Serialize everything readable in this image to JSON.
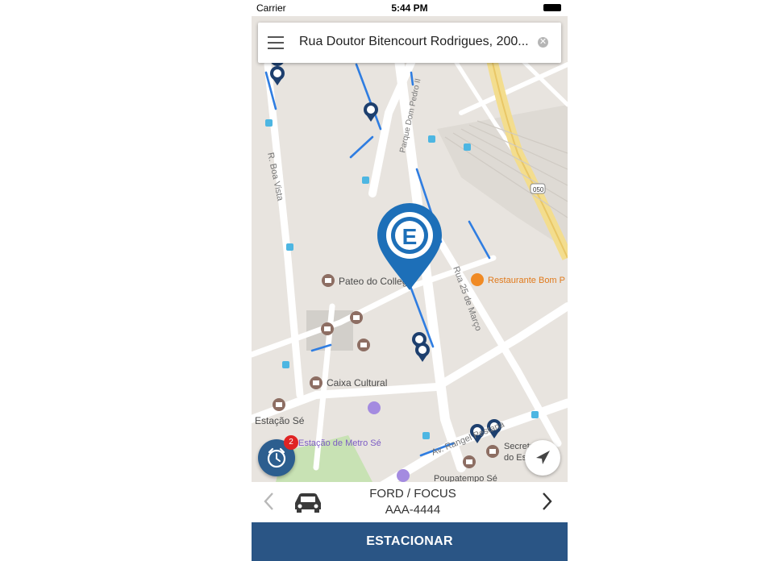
{
  "status_bar": {
    "carrier": "Carrier",
    "time": "5:44 PM"
  },
  "search": {
    "query": "Rua Doutor Bitencourt Rodrigues, 200..."
  },
  "map": {
    "labels": {
      "pateo": "Pateo do Collegio",
      "caixa": "Caixa Cultural",
      "estacao_se": "Estação Sé",
      "metro_se": "Estação de Metro Sé",
      "restaurante": "Restaurante Bom P",
      "secretaria_l1": "Secreta",
      "secretaria_l2": "do Es",
      "poupatempo": "Poupatempo Sé",
      "rua_25": "Rua 25 de Março",
      "boa_vista": "R. Boa Vista",
      "parque_dom_pedro": "Parque Dom Pedro II",
      "rangel": "Av. Rangel Pestana",
      "shield_050": "050",
      "parking_letter": "E"
    }
  },
  "timer": {
    "badge_count": "2"
  },
  "vehicle": {
    "model": "FORD / FOCUS",
    "plate": "AAA-4444"
  },
  "actions": {
    "park": "ESTACIONAR"
  },
  "colors": {
    "primary": "#2a5585",
    "pin": "#1d6fb8",
    "badge": "#e02424",
    "parking_line": "#2f7de1"
  }
}
